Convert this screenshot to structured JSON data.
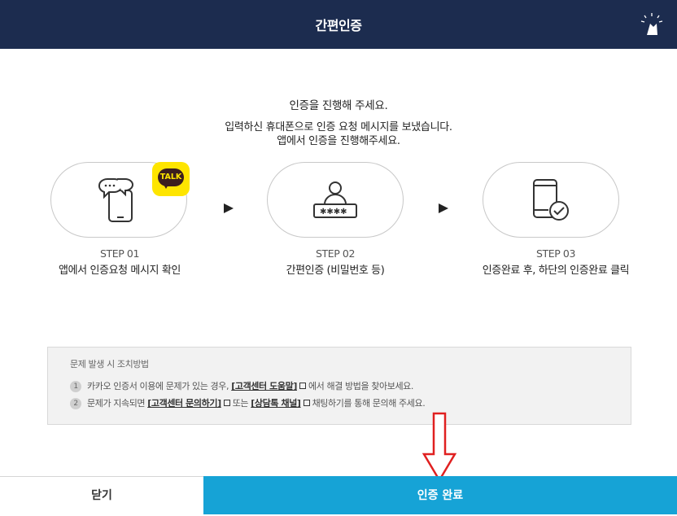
{
  "header": {
    "title": "간편인증"
  },
  "intro": {
    "line1": "인증을 진행해 주세요.",
    "line2": "입력하신 휴대폰으로 인증 요청 메시지를 보냈습니다.",
    "line3": "앱에서 인증을 진행해주세요."
  },
  "steps": [
    {
      "num": "STEP 01",
      "desc": "앱에서 인증요청 메시지 확인",
      "icon": "phone-message-icon",
      "badge": "TALK"
    },
    {
      "num": "STEP 02",
      "desc": "간편인증 (비밀번호 등)",
      "icon": "user-password-icon"
    },
    {
      "num": "STEP 03",
      "desc": "인증완료 후, 하단의 인증완료 클릭",
      "icon": "phone-check-icon"
    }
  ],
  "help": {
    "title": "문제 발생 시 조치방법",
    "items": [
      {
        "no": "1",
        "pre": "카카오 인증서 이용에 문제가 있는 경우,",
        "link": "[고객센터 도움말]",
        "post": "에서 해결 방법을 찾아보세요."
      },
      {
        "no": "2",
        "pre": "문제가 지속되면",
        "link": "[고객센터 문의하기]",
        "mid": "또는",
        "link2": "[상담톡 채널]",
        "post": "채팅하기를 통해 문의해 주세요."
      }
    ]
  },
  "buttons": {
    "close": "닫기",
    "done": "인증 완료"
  },
  "colors": {
    "header": "#1c2c4f",
    "primary": "#16a3d6",
    "kakao": "#fee500",
    "annotation": "#e02020"
  }
}
